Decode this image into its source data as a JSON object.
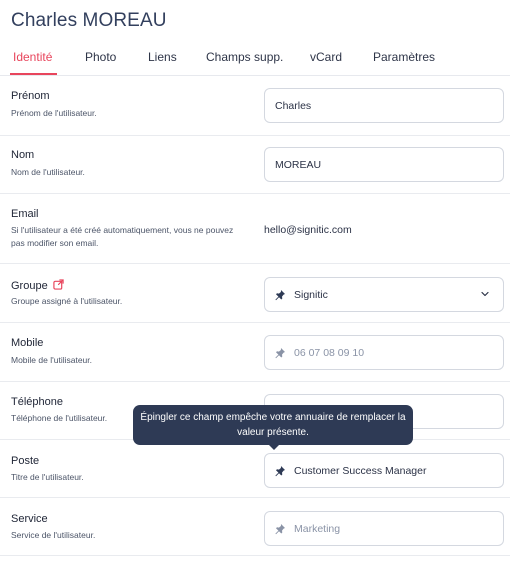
{
  "page_title": "Charles MOREAU",
  "tabs": [
    {
      "label": "Identité",
      "active": true
    },
    {
      "label": "Photo"
    },
    {
      "label": "Liens"
    },
    {
      "label": "Champs supp."
    },
    {
      "label": "vCard"
    },
    {
      "label": "Paramètres"
    }
  ],
  "fields": {
    "prenom": {
      "label": "Prénom",
      "desc": "Prénom de l'utilisateur.",
      "value": "Charles"
    },
    "nom": {
      "label": "Nom",
      "desc": "Nom de l'utilisateur.",
      "value": "MOREAU"
    },
    "email": {
      "label": "Email",
      "desc": "Si l'utilisateur a été créé automatiquement, vous ne pouvez pas modifier son email.",
      "value": "hello@signitic.com"
    },
    "groupe": {
      "label": "Groupe",
      "desc": "Groupe assigné à l'utilisateur.",
      "value": "Signitic"
    },
    "mobile": {
      "label": "Mobile",
      "desc": "Mobile de l'utilisateur.",
      "placeholder": "06 07 08 09 10"
    },
    "telephone": {
      "label": "Téléphone",
      "desc": "Téléphone de l'utilisateur.",
      "value": ""
    },
    "poste": {
      "label": "Poste",
      "desc": "Titre de l'utilisateur.",
      "value": "Customer Success Manager"
    },
    "service": {
      "label": "Service",
      "desc": "Service de l'utilisateur.",
      "placeholder": "Marketing"
    }
  },
  "tooltip": {
    "text": "Épingler ce champ empêche votre annuaire de remplacer la valeur présente."
  },
  "colors": {
    "accent": "#e8455c",
    "tooltip_bg": "#2e3a55",
    "pin_active": "#2e3a55",
    "pin_inactive": "#8a93a6"
  },
  "icons": {
    "groupe_link": "external-link-icon",
    "pin": "pin-icon",
    "dropdown": "chevron-down-icon"
  }
}
